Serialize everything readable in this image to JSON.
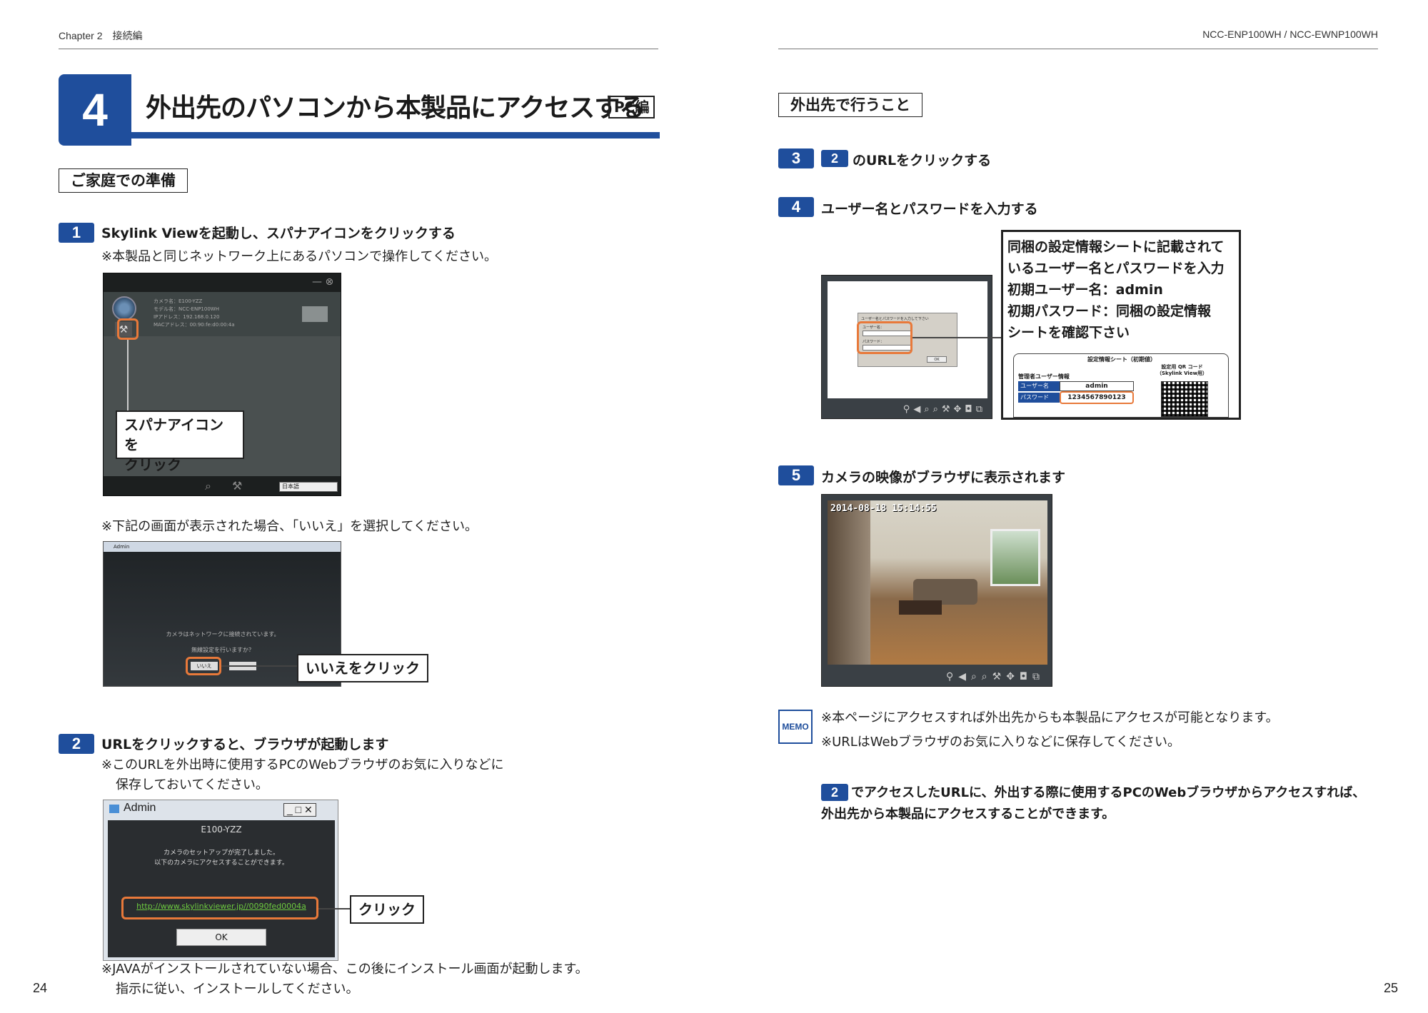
{
  "header": {
    "left": "Chapter 2　接続編",
    "right": "NCC-ENP100WH / NCC-EWNP100WH"
  },
  "chapter": {
    "number": "4",
    "title": "外出先のパソコンから本製品にアクセスする",
    "tag": "PC編"
  },
  "left": {
    "section": "ご家庭での準備",
    "step1": {
      "num": "1",
      "title": "Skylink Viewを起動し、スパナアイコンをクリックする",
      "note": "※本製品と同じネットワーク上にあるパソコンで操作してください。",
      "callout_line1": "スパナアイコンを",
      "callout_line2": "クリック",
      "shot": {
        "info1": "カメラ名：E100-YZZ",
        "info2": "モデル名：NCC-ENP100WH",
        "info3": "IPアドレス：192.168.0.120",
        "info4": "MACアドレス：00:90:fe:d0:00:4a",
        "lang": "日本語"
      }
    },
    "note2": "※下記の画面が表示された場合、「いいえ」を選択してください。",
    "shot2": {
      "title": "Admin",
      "msg1": "カメラはネットワークに接続されています。",
      "msg2": "無線設定を行いますか？",
      "no_btn": "いいえ",
      "callout": "いいえをクリック"
    },
    "step2": {
      "num": "2",
      "title": "URLをクリックすると、ブラウザが起動します",
      "note1": "※このURLを外出時に使用するPCのWebブラウザのお気に入りなどに",
      "note2": "保存しておいてください。",
      "shot": {
        "title": "Admin",
        "camera": "E100-YZZ",
        "msg1": "カメラのセットアップが完了しました。",
        "msg2": "以下のカメラにアクセスすることができます。",
        "url": "http://www.skylinkviewer.jp//0090fed0004a",
        "ok": "OK",
        "callout": "クリック"
      },
      "java1": "※JAVAがインストールされていない場合、この後にインストール画面が起動します。",
      "java2": "指示に従い、インストールしてください。"
    },
    "page": "24"
  },
  "right": {
    "section": "外出先で行うこと",
    "step3": {
      "num": "3",
      "ref": "2",
      "title": "のURLをクリックする"
    },
    "step4": {
      "num": "4",
      "title": "ユーザー名とパスワードを入力する",
      "box_line1": "同梱の設定情報シートに記載されて",
      "box_line2": "いるユーザー名とパスワードを入力",
      "box_line3": "初期ユーザー名：admin",
      "box_line4": "初期パスワード：同梱の設定情報",
      "box_line5": "シートを確認下さい",
      "sheet": {
        "title": "設定情報シート（初期値）",
        "admin_label": "管理者ユーザー情報",
        "qr_label1": "設定用 QR コード",
        "qr_label2": "（Skylink View用）",
        "user_key": "ユーザー名",
        "user_val": "admin",
        "pass_key": "パスワード",
        "pass_val": "1234567890123"
      },
      "login": {
        "prompt": "ユーザー名とパスワードを入力して下さい",
        "user": "ユーザー名：",
        "pass": "パスワード：",
        "ok": "OK"
      }
    },
    "step5": {
      "num": "5",
      "title": "カメラの映像がブラウザに表示されます",
      "timestamp": "2014-08-18 15:14:55"
    },
    "memo": {
      "label": "MEMO",
      "line1": "※本ページにアクセスすれば外出先からも本製品にアクセスが可能となります。",
      "line2": "※URLはWebブラウザのお気に入りなどに保存してください。"
    },
    "final": {
      "ref": "2",
      "line1": "でアクセスしたURLに、外出する際に使用するPCのWebブラウザからアクセスすれば、",
      "line2": "外出先から本製品にアクセスすることができます。"
    },
    "page": "25"
  },
  "colors": {
    "accent": "#1f4e9c",
    "highlight": "#e8793a"
  }
}
